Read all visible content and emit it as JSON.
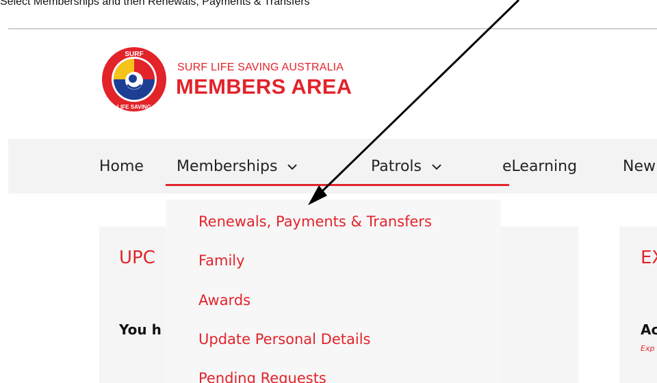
{
  "caption": {
    "before": "Select Memberships and then Renewals, Payments & Transfers",
    "bold": ""
  },
  "logo": {
    "badge_top": "SURF",
    "badge_bottom": "LIFE SAVING",
    "line1": "SURF LIFE SAVING AUSTRALIA",
    "line2": "MEMBERS AREA"
  },
  "nav": {
    "items": [
      {
        "label": "Home",
        "has_dropdown": false
      },
      {
        "label": "Memberships",
        "has_dropdown": true
      },
      {
        "label": "Patrols",
        "has_dropdown": true
      },
      {
        "label": "eLearning",
        "has_dropdown": false
      },
      {
        "label": "New",
        "has_dropdown": false
      }
    ]
  },
  "dropdown": {
    "items": [
      {
        "label": "Renewals, Payments & Transfers"
      },
      {
        "label": "Family"
      },
      {
        "label": "Awards"
      },
      {
        "label": "Update Personal Details"
      },
      {
        "label": "Pending Requests"
      }
    ]
  },
  "panels": {
    "left_heading": "UPC",
    "left_text": "You h",
    "right_heading": "EX",
    "right_text": "Ac",
    "right_sub": "Exp"
  },
  "colors": {
    "brand_red": "#e2232a",
    "brand_blue": "#1c3f94",
    "brand_yellow": "#f6c31b",
    "nav_bg": "#f3f3f3",
    "dropdown_bg": "#f7f7f7"
  }
}
